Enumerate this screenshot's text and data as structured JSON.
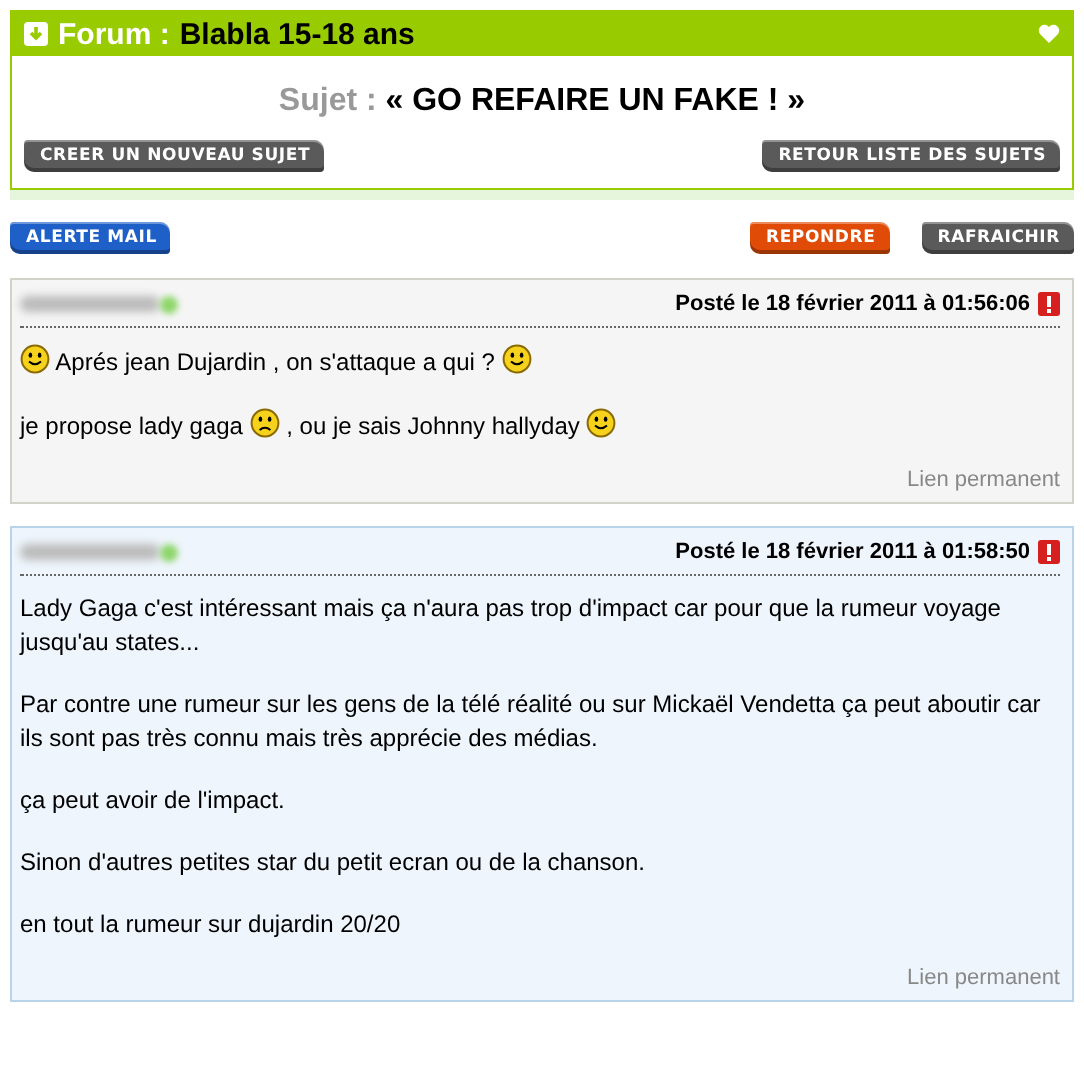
{
  "forum": {
    "label": "Forum :",
    "name": "Blabla 15-18 ans"
  },
  "topic": {
    "label": "Sujet :",
    "title": "« GO REFAIRE UN FAKE ! »"
  },
  "topic_buttons": [
    {
      "label": "CREER UN NOUVEAU SUJET",
      "color": "#5a5a5a"
    },
    {
      "label": "RETOUR LISTE DES SUJETS",
      "color": "#5a5a5a"
    }
  ],
  "action_buttons": {
    "left": [
      {
        "label": "ALERTE MAIL",
        "color": "#1f5fc8"
      }
    ],
    "right": [
      {
        "label": "REPONDRE",
        "color": "#e04c08"
      },
      {
        "label": "RAFRAICHIR",
        "color": "#5a5a5a"
      }
    ]
  },
  "posts": [
    {
      "highlighted": false,
      "date": "Posté le 18 février 2011 à 01:56:06",
      "link": "Lien permanent",
      "paragraphs": [
        [
          {
            "kind": "smile"
          },
          {
            "kind": "text",
            "text": "Aprés jean Dujardin , on s'attaque a qui ?"
          },
          {
            "kind": "smile"
          }
        ],
        [
          {
            "kind": "text",
            "text": "je propose lady gaga"
          },
          {
            "kind": "frown"
          },
          {
            "kind": "text",
            "text": ", ou je sais Johnny hallyday"
          },
          {
            "kind": "smile"
          }
        ]
      ]
    },
    {
      "highlighted": true,
      "date": "Posté le 18 février 2011 à 01:58:50",
      "link": "Lien permanent",
      "paragraphs": [
        [
          {
            "kind": "text",
            "text": "Lady Gaga c'est intéressant mais ça n'aura pas trop d'impact car pour que la rumeur voyage jusqu'au states..."
          }
        ],
        [
          {
            "kind": "text",
            "text": "Par contre une rumeur sur les gens de la télé réalité ou sur Mickaël Vendetta ça peut aboutir car ils sont pas très connu mais très apprécie des médias."
          }
        ],
        [
          {
            "kind": "text",
            "text": "ça peut avoir de l'impact."
          }
        ],
        [
          {
            "kind": "text",
            "text": "Sinon d'autres petites star du petit ecran ou de la chanson."
          }
        ],
        [
          {
            "kind": "text",
            "text": "en tout la rumeur sur dujardin 20/20"
          }
        ]
      ]
    }
  ]
}
